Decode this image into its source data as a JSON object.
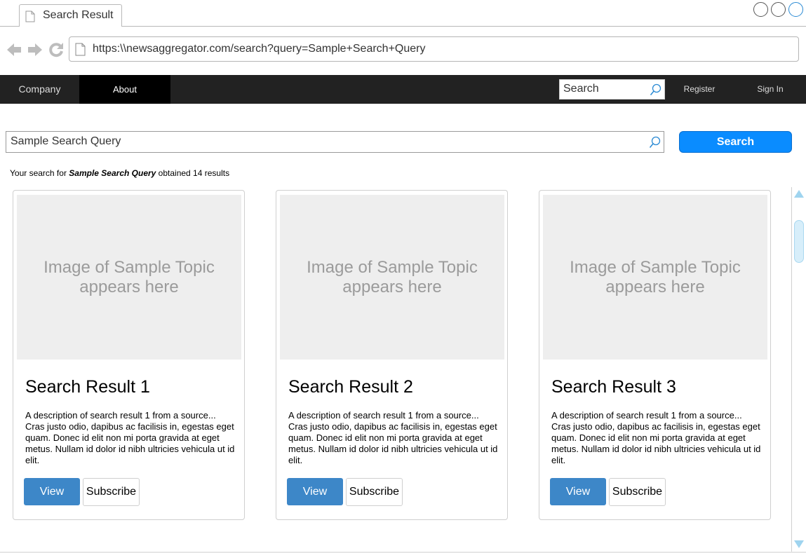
{
  "browser": {
    "tab_title": "Search Result",
    "url": "https:\\\\newsaggregator.com/search?query=Sample+Search+Query"
  },
  "nav": {
    "company": "Company",
    "about": "About",
    "search_placeholder": "Search",
    "register": "Register",
    "sign_in": "Sign In"
  },
  "search": {
    "query": "Sample Search Query",
    "button": "Search",
    "summary_prefix": "Your search for ",
    "summary_query": "Sample Search Query",
    "summary_suffix": " obtained 14 results"
  },
  "results": [
    {
      "image_text": "Image of Sample Topic appears here",
      "title": "Search Result 1",
      "description": "A description of search result 1 from a source... Cras justo odio, dapibus ac facilisis in, egestas eget quam. Donec id elit non mi porta gravida at eget metus. Nullam id dolor id nibh ultricies vehicula ut id elit.",
      "view_label": "View",
      "subscribe_label": "Subscribe"
    },
    {
      "image_text": "Image of Sample Topic appears here",
      "title": "Search Result 2",
      "description": "A description of search result 1 from a source... Cras justo odio, dapibus ac facilisis in, egestas eget quam. Donec id elit non mi porta gravida at eget metus. Nullam id dolor id nibh ultricies vehicula ut id elit.",
      "view_label": "View",
      "subscribe_label": "Subscribe"
    },
    {
      "image_text": "Image of Sample Topic appears here",
      "title": "Search Result 3",
      "description": "A description of search result 1 from a source... Cras justo odio, dapibus ac facilisis in, egestas eget quam. Donec id elit non mi porta gravida at eget metus. Nullam id dolor id nibh ultricies vehicula ut id elit.",
      "view_label": "View",
      "subscribe_label": "Subscribe"
    }
  ],
  "colors": {
    "nav_bg": "#222222",
    "nav_active_bg": "#000000",
    "primary_button": "#0a8cff",
    "view_button": "#3d87c8",
    "image_placeholder": "#eeeeee"
  },
  "icons": {
    "tab": "page-icon",
    "back": "back-arrow-icon",
    "forward": "forward-arrow-icon",
    "reload": "reload-icon",
    "url": "page-icon",
    "search": "magnifier-icon"
  }
}
